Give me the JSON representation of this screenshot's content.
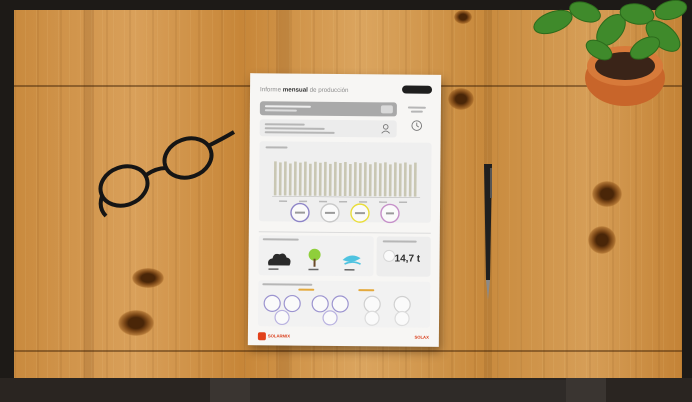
{
  "scene": {
    "table_color": "#d29a52",
    "paper_color": "#f7f6f4",
    "accent_red": "#e2411b"
  },
  "report": {
    "title_prefix": "Informe",
    "title_bold": "mensual",
    "title_suffix": "de producción",
    "total_value": "14,7 t",
    "footer_left": "SOLARMIX",
    "footer_right": "SOLAX"
  }
}
